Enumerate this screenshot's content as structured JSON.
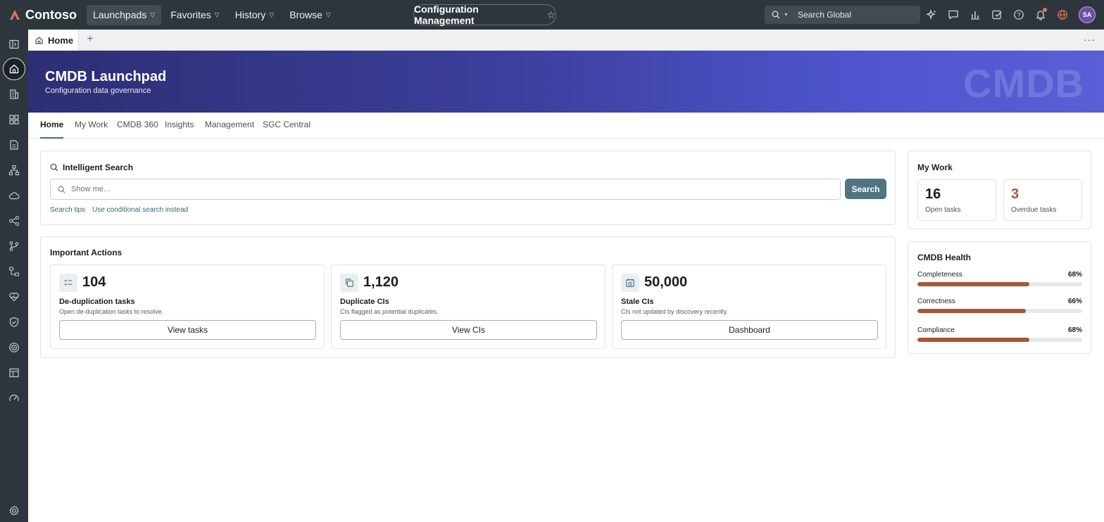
{
  "topbar": {
    "brand": "Contoso",
    "nav": [
      {
        "label": "Launchpads",
        "active": true
      },
      {
        "label": "Favorites",
        "active": false
      },
      {
        "label": "History",
        "active": false
      },
      {
        "label": "Browse",
        "active": false
      }
    ],
    "context_title": "Configuration Management",
    "search_placeholder": "Search Global",
    "icons": [
      "sparkle-icon",
      "chat-icon",
      "chart-icon",
      "checklist-icon",
      "help-icon",
      "bell-icon",
      "globe-icon"
    ],
    "avatar_initials": "SA"
  },
  "rail": {
    "items": [
      "sidebar-toggle-icon",
      "home-icon",
      "building-icon",
      "apps-icon",
      "document-icon",
      "hierarchy-icon",
      "cloud-icon",
      "share-icon",
      "branch-icon",
      "workflow-icon",
      "heart-icon",
      "shield-icon",
      "target-icon",
      "table-icon",
      "gauge-icon"
    ],
    "settings_icon": "gear-icon"
  },
  "tabs": {
    "home_label": "Home"
  },
  "banner": {
    "title": "CMDB Launchpad",
    "subtitle": "Configuration data governance",
    "watermark": "CMDB"
  },
  "subtabs": [
    {
      "label": "Home",
      "active": true
    },
    {
      "label": "My Work",
      "active": false
    },
    {
      "label": "CMDB 360",
      "active": false
    },
    {
      "label": "Insights",
      "active": false
    },
    {
      "label": "Management",
      "active": false
    },
    {
      "label": "SGC Central",
      "active": false
    }
  ],
  "intelligent_search": {
    "title": "Intelligent Search",
    "placeholder": "Show me…",
    "button": "Search",
    "links": [
      "Search tips",
      "Use conditional search instead"
    ]
  },
  "important_actions": {
    "title": "Important Actions",
    "items": [
      {
        "count": "104",
        "name": "De-duplication tasks",
        "description": "Open de-duplication tasks to resolve.",
        "button": "View tasks",
        "icon": "checklist-icon"
      },
      {
        "count": "1,120",
        "name": "Duplicate CIs",
        "description": "CIs flagged as potential duplicates.",
        "button": "View CIs",
        "icon": "copy-icon"
      },
      {
        "count": "50,000",
        "name": "Stale CIs",
        "description": "CIs not updated by discovery recently.",
        "button": "Dashboard",
        "icon": "calendar-clock-icon"
      }
    ]
  },
  "my_work": {
    "title": "My Work",
    "open_tasks": {
      "value": "16",
      "label": "Open tasks"
    },
    "overdue_tasks": {
      "value": "3",
      "label": "Overdue tasks",
      "color": "#a85639"
    }
  },
  "cmdb_health": {
    "title": "CMDB Health",
    "metrics": [
      {
        "label": "Completeness",
        "percent_label": "68%",
        "value": 0.68
      },
      {
        "label": "Correctness",
        "percent_label": "66%",
        "value": 0.66
      },
      {
        "label": "Compliance",
        "percent_label": "68%",
        "value": 0.68
      }
    ],
    "bar_color": "#a85639"
  },
  "colors": {
    "topbar": "#2e363d",
    "accent": "#3b7768",
    "search_button": "#4f7580",
    "banner_start": "#2d2e73",
    "banner_end": "#5a5fd6"
  }
}
